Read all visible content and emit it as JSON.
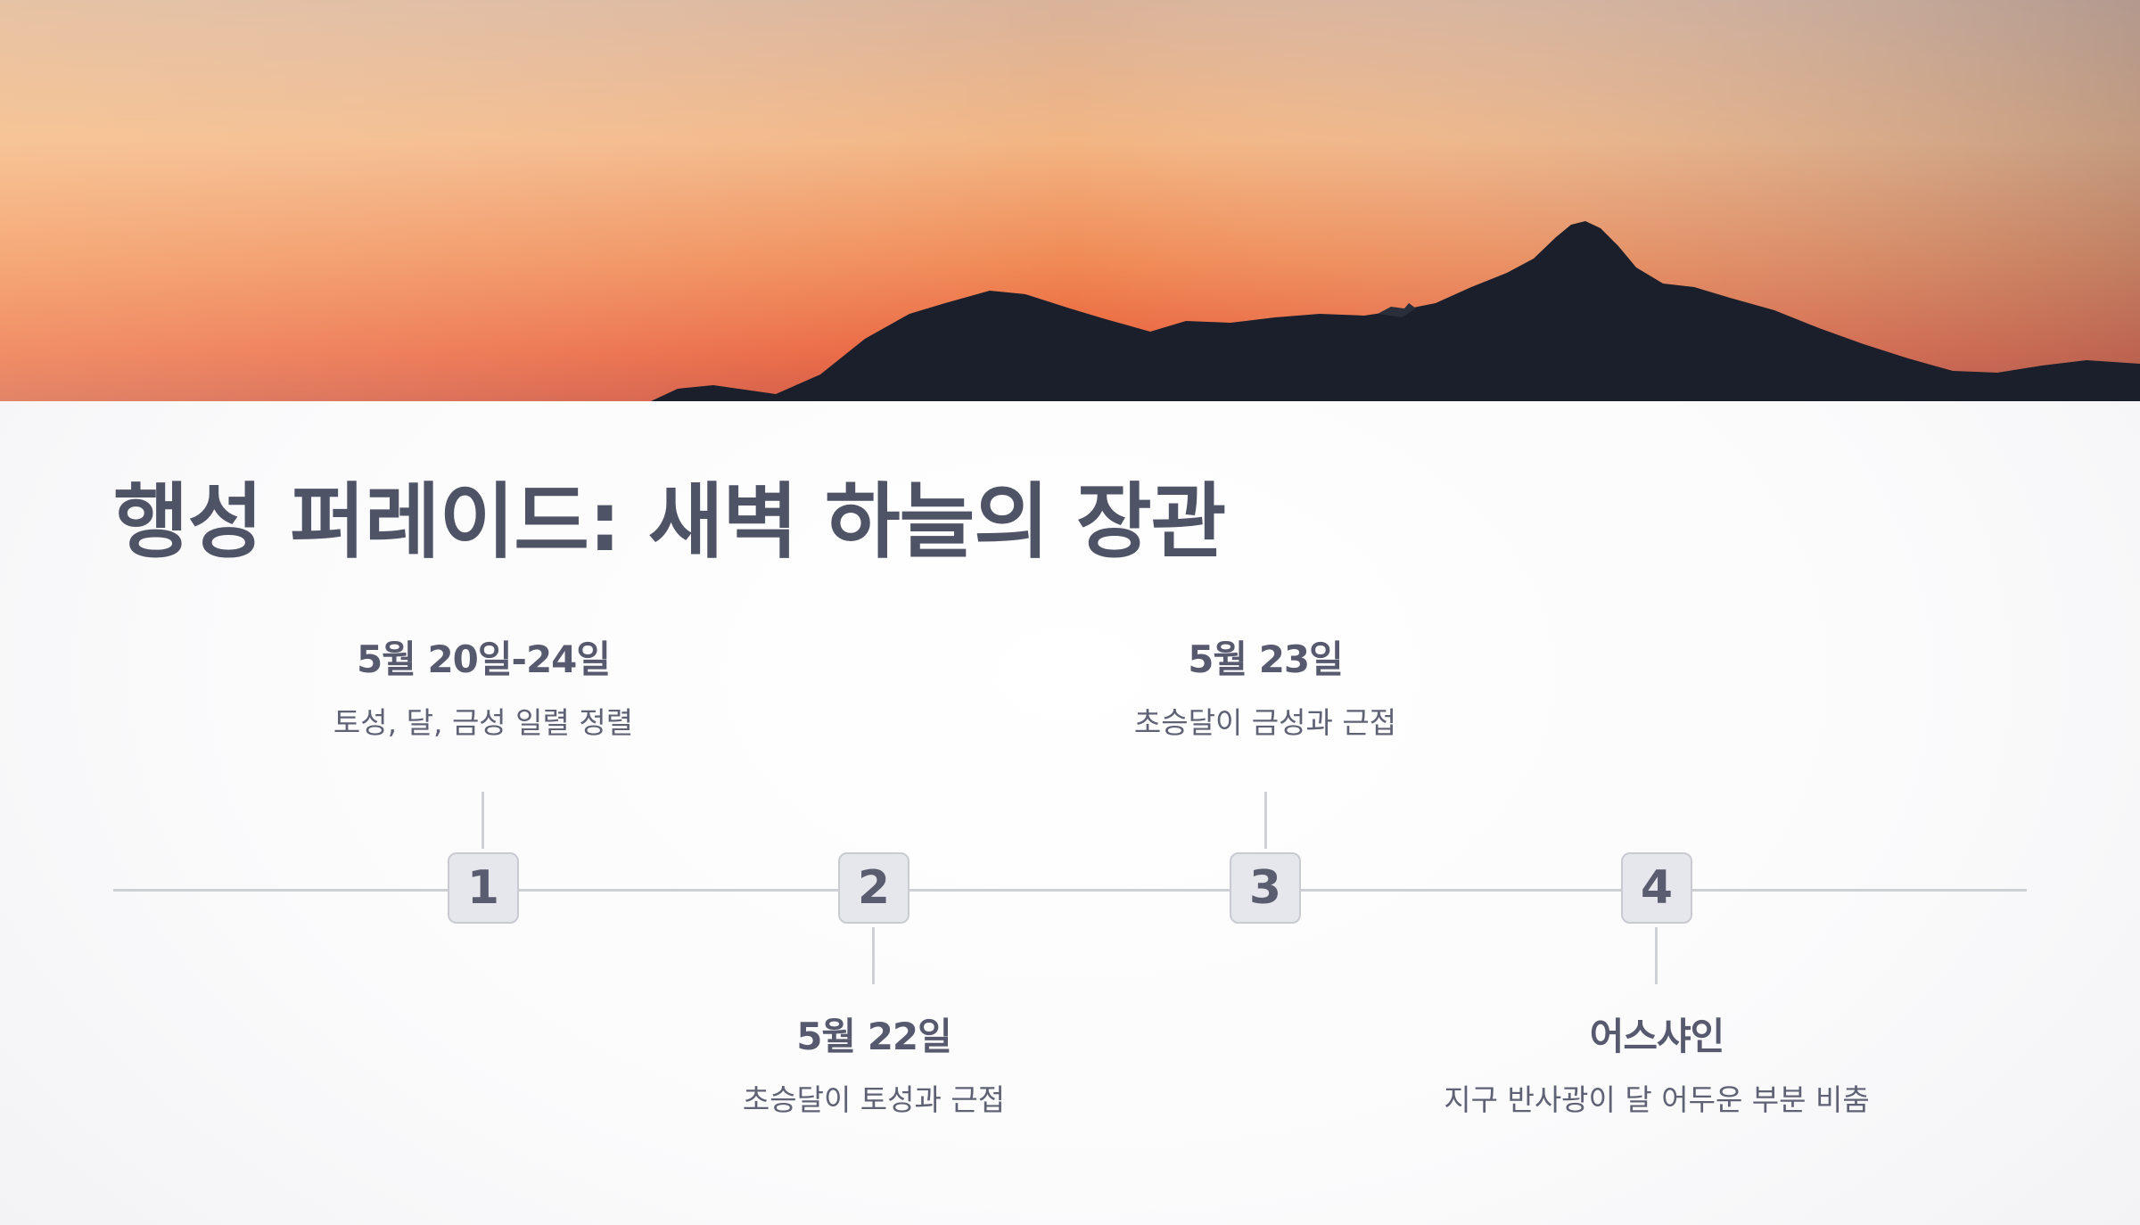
{
  "slide": {
    "title": "행성 퍼레이드: 새벽 하늘의 장관"
  },
  "timeline": {
    "events": [
      {
        "number": "1",
        "date": "5월 20일-24일",
        "description": "토성, 달, 금성 일렬 정렬"
      },
      {
        "number": "2",
        "date": "5월 22일",
        "description": "초승달이 토성과 근접"
      },
      {
        "number": "3",
        "date": "5월 23일",
        "description": "초승달이 금성과 근접"
      },
      {
        "number": "4",
        "date": "어스샤인",
        "description": "지구 반사광이 달 어두운 부분 비춤"
      }
    ]
  },
  "colors": {
    "title": "#4f5366",
    "line": "#cfd0d6",
    "marker_fill": "#e6e7ec",
    "sky_top": "#c2a08c",
    "sky_horizon": "#ee6a3c",
    "mountain": "#1b1e2b"
  }
}
